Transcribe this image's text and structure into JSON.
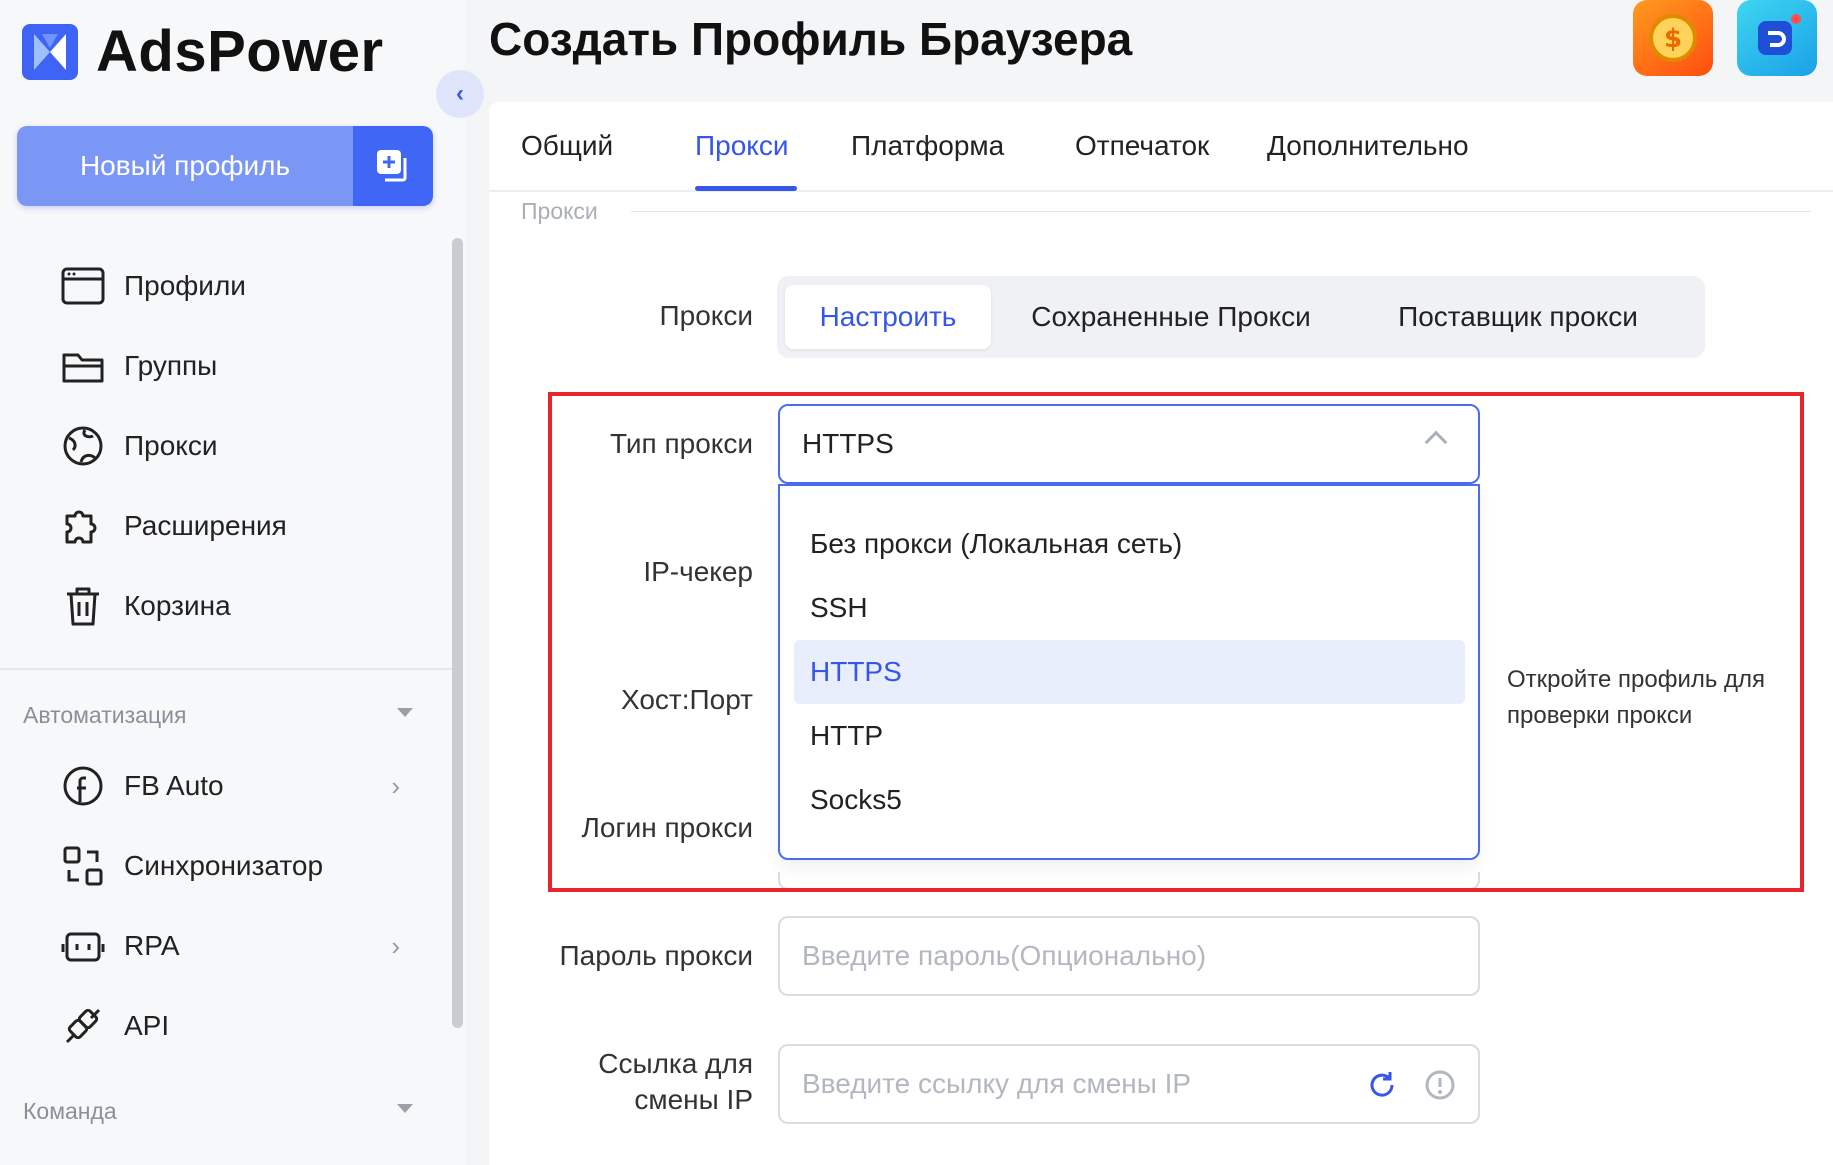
{
  "app": {
    "name": "AdsPower",
    "page_title": "Создать Профиль Браузера"
  },
  "sidebar": {
    "new_profile_label": "Новый профиль",
    "items": [
      {
        "label": "Профили",
        "icon": "browser-window-icon"
      },
      {
        "label": "Группы",
        "icon": "folder-icon"
      },
      {
        "label": "Прокси",
        "icon": "globe-icon"
      },
      {
        "label": "Расширения",
        "icon": "puzzle-icon"
      },
      {
        "label": "Корзина",
        "icon": "trash-icon"
      }
    ],
    "section_automation": "Автоматизация",
    "automation_items": [
      {
        "label": "FB Auto",
        "icon": "facebook-icon",
        "has_chevron": true
      },
      {
        "label": "Синхронизатор",
        "icon": "sync-icon",
        "has_chevron": false
      },
      {
        "label": "RPA",
        "icon": "robot-icon",
        "has_chevron": true
      },
      {
        "label": "API",
        "icon": "plug-icon",
        "has_chevron": false
      }
    ],
    "section_team": "Команда"
  },
  "tabs": [
    {
      "label": "Общий",
      "active": false
    },
    {
      "label": "Прокси",
      "active": true
    },
    {
      "label": "Платформа",
      "active": false
    },
    {
      "label": "Отпечаток",
      "active": false
    },
    {
      "label": "Дополнительно",
      "active": false
    }
  ],
  "section_heading": "Прокси",
  "form": {
    "proxy_label": "Прокси",
    "proxy_modes": [
      {
        "label": "Настроить",
        "active": true
      },
      {
        "label": "Сохраненные Прокси",
        "active": false
      },
      {
        "label": "Поставщик прокси",
        "active": false
      }
    ],
    "proxy_type_label": "Тип прокси",
    "proxy_type_value": "HTTPS",
    "proxy_type_options": [
      {
        "label": "Без прокси (Локальная сеть)",
        "selected": false
      },
      {
        "label": "SSH",
        "selected": false
      },
      {
        "label": "HTTPS",
        "selected": true
      },
      {
        "label": "HTTP",
        "selected": false
      },
      {
        "label": "Socks5",
        "selected": false
      }
    ],
    "ip_checker_label": "IP-чекер",
    "host_port_label": "Хост:Порт",
    "login_label": "Логин прокси",
    "password_label": "Пароль прокси",
    "password_placeholder": "Введите пароль(Опционально)",
    "ip_change_link_label_1": "Ссылка для",
    "ip_change_link_label_2": "смены IP",
    "ip_change_link_placeholder": "Введите ссылку для смены IP",
    "check_hint": "Откройте профиль для проверки прокси"
  },
  "colors": {
    "accent": "#3556e8",
    "highlight_border": "#e8262b",
    "new_profile_bg": "#7a97f6"
  }
}
